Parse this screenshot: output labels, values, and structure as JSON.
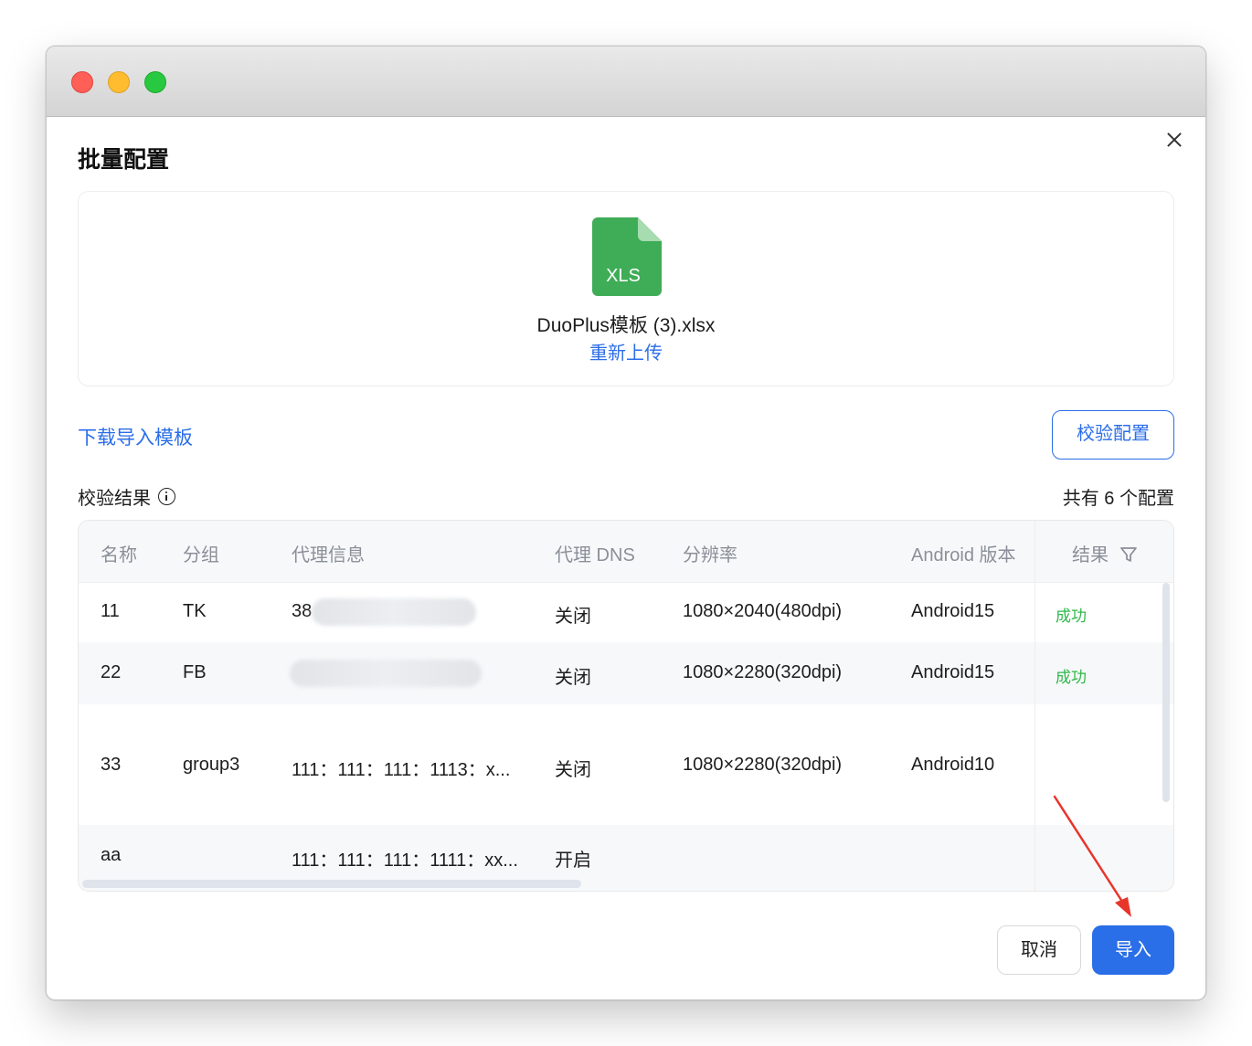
{
  "dialog": {
    "title": "批量配置",
    "file_name": "DuoPlus模板 (3).xlsx",
    "file_badge": "XLS",
    "reupload_label": "重新上传",
    "download_template_label": "下载导入模板",
    "verify_button_label": "校验配置",
    "result_label": "校验结果",
    "count_label": "共有 6 个配置",
    "cancel_label": "取消",
    "import_label": "导入"
  },
  "table": {
    "headers": {
      "name": "名称",
      "group": "分组",
      "proxy": "代理信息",
      "dns": "代理 DNS",
      "resolution": "分辨率",
      "android": "Android 版本",
      "result": "结果"
    },
    "rows": [
      {
        "name": "11",
        "group": "TK",
        "proxy": "38",
        "dns": "关闭",
        "resolution": "1080×2040(480dpi)",
        "android": "Android15",
        "result": "成功"
      },
      {
        "name": "22",
        "group": "FB",
        "proxy": "",
        "dns": "关闭",
        "resolution": "1080×2280(320dpi)",
        "android": "Android15",
        "result": "成功"
      },
      {
        "name": "33",
        "group": "group3",
        "proxy": "111：111：111：1113：x...",
        "dns": "关闭",
        "resolution": "1080×2280(320dpi)",
        "android": "Android10",
        "result": ""
      },
      {
        "name": "aa",
        "group": "",
        "proxy": "111：111：111：1111：xx...",
        "dns": "开启",
        "resolution": "",
        "android": "",
        "result": ""
      }
    ]
  },
  "colors": {
    "accent": "#2a6ee8",
    "success": "#2fb84a",
    "file_icon": "#3fad57",
    "annotation_arrow": "#e8352b"
  },
  "icons": {
    "close": "close-icon",
    "info": "info-icon",
    "filter": "filter-icon",
    "file": "xls-file-icon"
  }
}
